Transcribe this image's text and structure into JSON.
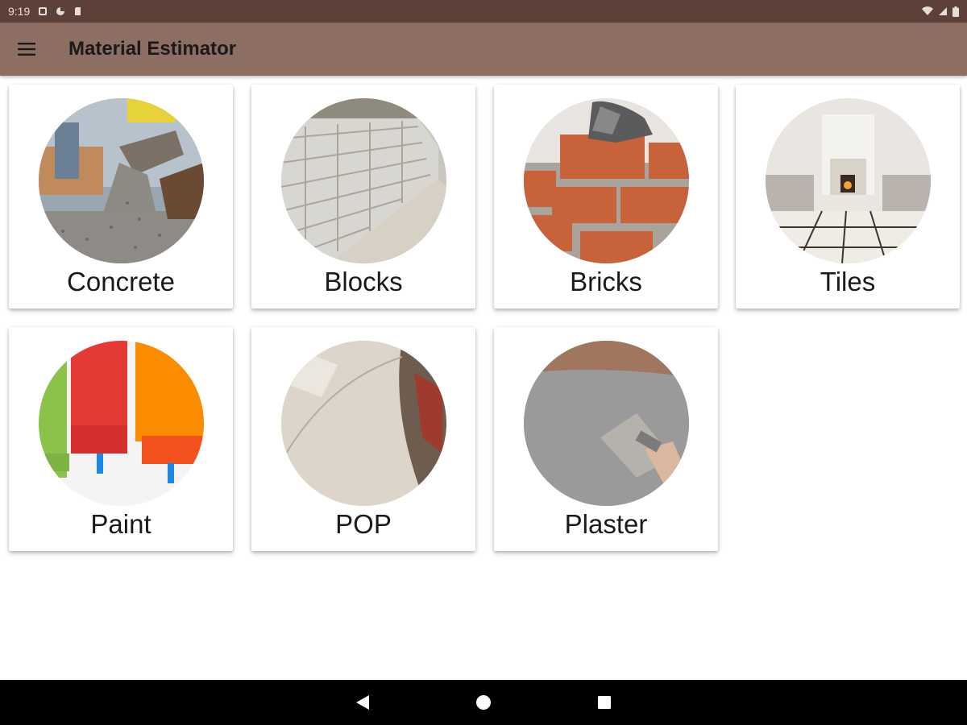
{
  "status_bar": {
    "time": "9:19"
  },
  "app_bar": {
    "title": "Material Estimator",
    "menu_icon": "hamburger-menu-icon"
  },
  "materials": [
    {
      "label": "Concrete",
      "image": "concrete-pour-photo"
    },
    {
      "label": "Blocks",
      "image": "block-wall-photo"
    },
    {
      "label": "Bricks",
      "image": "brick-laying-photo"
    },
    {
      "label": "Tiles",
      "image": "tiled-room-photo"
    },
    {
      "label": "Paint",
      "image": "paint-rollers-photo"
    },
    {
      "label": "POP",
      "image": "pop-ceiling-photo"
    },
    {
      "label": "Plaster",
      "image": "plaster-trowel-photo"
    }
  ],
  "nav_bar": {
    "back_icon": "back-triangle-icon",
    "home_icon": "home-circle-icon",
    "recents_icon": "recents-square-icon"
  },
  "colors": {
    "status_bar": "#5d4037",
    "app_bar": "#8d6e63",
    "background": "#ffffff",
    "nav_bar": "#000000"
  }
}
